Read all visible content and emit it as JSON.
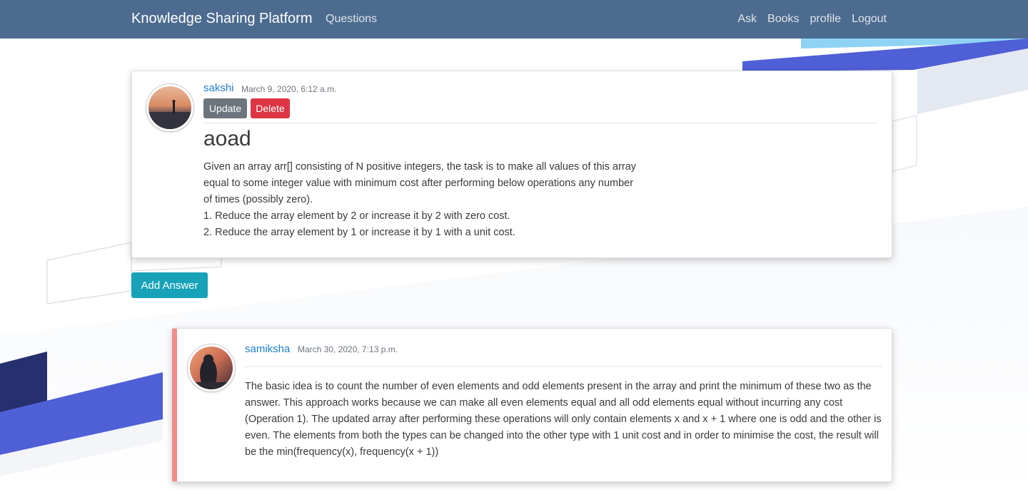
{
  "navbar": {
    "brand": "Knowledge Sharing Platform",
    "questions_link": "Questions",
    "right_links": [
      {
        "label": "Ask"
      },
      {
        "label": "Books"
      },
      {
        "label": "profile"
      },
      {
        "label": "Logout"
      }
    ]
  },
  "question": {
    "author": "sakshi",
    "timestamp": "March 9, 2020, 6:12 a.m.",
    "update_label": "Update",
    "delete_label": "Delete",
    "title": "aoad",
    "body": "Given an array arr[] consisting of N positive integers, the task is to make all values of this array equal to some integer value with minimum cost after performing below operations any number of times (possibly zero).\n1. Reduce the array element by 2 or increase it by 2 with zero cost.\n2. Reduce the array element by 1 or increase it by 1 with a unit cost."
  },
  "add_answer_label": "Add Answer",
  "answers": [
    {
      "author": "samiksha",
      "timestamp": "March 30, 2020, 7:13 p.m.",
      "body": "The basic idea is to count the number of even elements and odd elements present in the array and print the minimum of these two as the answer. This approach works because we can make all even elements equal and all odd elements equal without incurring any cost (Operation 1). The updated array after performing these operations will only contain elements x and x + 1 where one is odd and the other is even. The elements from both the types can be changed into the other type with 1 unit cost and in order to minimise the cost, the result will be the min(frequency(x), frequency(x + 1))"
    }
  ],
  "colors": {
    "navbar": "#4c6b8f",
    "link": "#1f7fd1",
    "update_button": "#6c757d",
    "delete_button": "#dc3545",
    "add_answer_button": "#17a2b8",
    "answer_accent": "#f28b8b",
    "decor_blue": "#4f5fd6",
    "decor_navy": "#27306e"
  }
}
